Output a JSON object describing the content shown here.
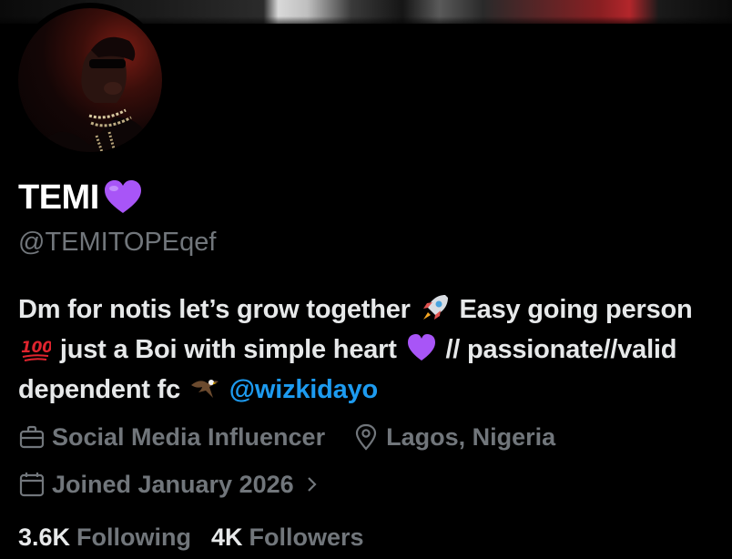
{
  "profile": {
    "display_name": "TEMI",
    "name_emoji": "purple-heart-emoji",
    "handle": "@TEMITOPEqef",
    "bio": {
      "part1": "Dm for notis let’s grow together",
      "part2": "Easy going person",
      "part3": "just a Boi with simple heart",
      "part4": "// passionate//valid dependent fc",
      "mention": "@wizkidayo"
    },
    "profession": "Social Media Influencer",
    "location": "Lagos, Nigeria",
    "joined": "Joined January 2026",
    "following_count": "3.6K",
    "following_label": "Following",
    "followers_count": "4K",
    "followers_label": "Followers"
  },
  "icons": {
    "profession": "briefcase-icon",
    "location": "location-pin-icon",
    "joined": "calendar-icon",
    "joined_more": "chevron-right-icon"
  },
  "colors": {
    "background": "#000000",
    "primary_text": "#e7e9ea",
    "secondary_text": "#71767b",
    "link": "#1d9bf0",
    "heart": "#a855f7"
  }
}
